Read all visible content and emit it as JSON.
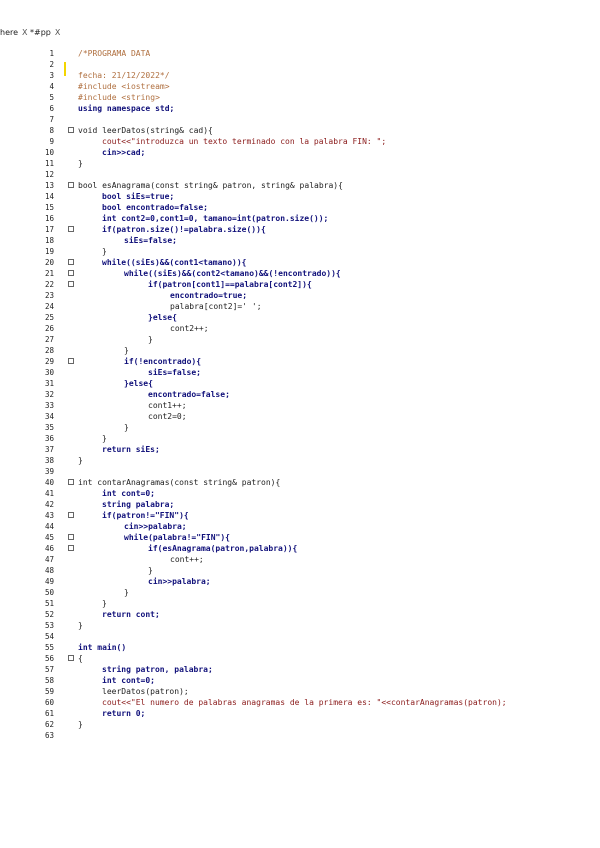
{
  "tabs": [
    {
      "label": "here",
      "close": "X"
    },
    {
      "label": "*#pp",
      "close": "X"
    }
  ],
  "lines": [
    {
      "n": "1",
      "indent": 0,
      "text": "/*PROGRAMA DATA",
      "cls": "com"
    },
    {
      "n": "2",
      "indent": 0,
      "text": "",
      "cls": ""
    },
    {
      "n": "3",
      "indent": 0,
      "text": "fecha: 21/12/2022*/",
      "cls": "com"
    },
    {
      "n": "4",
      "indent": 0,
      "text": "#include <iostream>",
      "cls": "com"
    },
    {
      "n": "5",
      "indent": 0,
      "text": "#include <string>",
      "cls": "com"
    },
    {
      "n": "6",
      "indent": 0,
      "text": "using namespace std;",
      "cls": "kw"
    },
    {
      "n": "7",
      "indent": 0,
      "text": "",
      "cls": ""
    },
    {
      "n": "8",
      "indent": 0,
      "text": "void leerDatos(string& cad){",
      "cls": "",
      "fold": true
    },
    {
      "n": "9",
      "indent": 1,
      "text": "cout<<\"introduzca un texto terminado con la palabra FIN: \";",
      "cls": "str"
    },
    {
      "n": "10",
      "indent": 1,
      "text": "cin>>cad;",
      "cls": "kw"
    },
    {
      "n": "11",
      "indent": 0,
      "text": "}",
      "cls": ""
    },
    {
      "n": "12",
      "indent": 0,
      "text": "",
      "cls": ""
    },
    {
      "n": "13",
      "indent": 0,
      "text": "bool esAnagrama(const string& patron, string& palabra){",
      "cls": "",
      "fold": true
    },
    {
      "n": "14",
      "indent": 1,
      "text": "bool siEs=true;",
      "cls": "kw"
    },
    {
      "n": "15",
      "indent": 1,
      "text": "bool encontrado=false;",
      "cls": "kw"
    },
    {
      "n": "16",
      "indent": 1,
      "text": "int cont2=0,cont1=0, tamano=int(patron.size());",
      "cls": "kw"
    },
    {
      "n": "17",
      "indent": 1,
      "text": "if(patron.size()!=palabra.size()){",
      "cls": "kw",
      "fold": true
    },
    {
      "n": "18",
      "indent": 2,
      "text": "siEs=false;",
      "cls": "kw"
    },
    {
      "n": "19",
      "indent": 1,
      "text": "}",
      "cls": ""
    },
    {
      "n": "20",
      "indent": 1,
      "text": "while((siEs)&&(cont1<tamano)){",
      "cls": "kw",
      "fold": true
    },
    {
      "n": "21",
      "indent": 2,
      "text": "while((siEs)&&(cont2<tamano)&&(!encontrado)){",
      "cls": "kw",
      "fold": true
    },
    {
      "n": "22",
      "indent": 3,
      "text": "if(patron[cont1]==palabra[cont2]){",
      "cls": "kw",
      "fold": true
    },
    {
      "n": "23",
      "indent": 4,
      "text": "encontrado=true;",
      "cls": "kw"
    },
    {
      "n": "24",
      "indent": 4,
      "text": "palabra[cont2]=' ';",
      "cls": ""
    },
    {
      "n": "25",
      "indent": 3,
      "text": "}else{",
      "cls": "kw"
    },
    {
      "n": "26",
      "indent": 4,
      "text": "cont2++;",
      "cls": ""
    },
    {
      "n": "27",
      "indent": 3,
      "text": "}",
      "cls": ""
    },
    {
      "n": "28",
      "indent": 2,
      "text": "}",
      "cls": ""
    },
    {
      "n": "29",
      "indent": 2,
      "text": "if(!encontrado){",
      "cls": "kw",
      "fold": true
    },
    {
      "n": "30",
      "indent": 3,
      "text": "siEs=false;",
      "cls": "kw"
    },
    {
      "n": "31",
      "indent": 2,
      "text": "}else{",
      "cls": "kw"
    },
    {
      "n": "32",
      "indent": 3,
      "text": "encontrado=false;",
      "cls": "kw"
    },
    {
      "n": "33",
      "indent": 3,
      "text": "cont1++;",
      "cls": ""
    },
    {
      "n": "34",
      "indent": 3,
      "text": "cont2=0;",
      "cls": ""
    },
    {
      "n": "35",
      "indent": 2,
      "text": "}",
      "cls": ""
    },
    {
      "n": "36",
      "indent": 1,
      "text": "}",
      "cls": ""
    },
    {
      "n": "37",
      "indent": 1,
      "text": "return siEs;",
      "cls": "kw"
    },
    {
      "n": "38",
      "indent": 0,
      "text": "}",
      "cls": ""
    },
    {
      "n": "39",
      "indent": 0,
      "text": "",
      "cls": ""
    },
    {
      "n": "40",
      "indent": 0,
      "text": "int contarAnagramas(const string& patron){",
      "cls": "",
      "fold": true
    },
    {
      "n": "41",
      "indent": 1,
      "text": "int cont=0;",
      "cls": "kw"
    },
    {
      "n": "42",
      "indent": 1,
      "text": "string palabra;",
      "cls": "kw"
    },
    {
      "n": "43",
      "indent": 1,
      "text": "if(patron!=\"FIN\"){",
      "cls": "kw",
      "fold": true
    },
    {
      "n": "44",
      "indent": 2,
      "text": "cin>>palabra;",
      "cls": "kw"
    },
    {
      "n": "45",
      "indent": 2,
      "text": "while(palabra!=\"FIN\"){",
      "cls": "kw",
      "fold": true
    },
    {
      "n": "46",
      "indent": 3,
      "text": "if(esAnagrama(patron,palabra)){",
      "cls": "kw",
      "fold": true
    },
    {
      "n": "47",
      "indent": 4,
      "text": "cont++;",
      "cls": ""
    },
    {
      "n": "48",
      "indent": 3,
      "text": "}",
      "cls": ""
    },
    {
      "n": "49",
      "indent": 3,
      "text": "cin>>palabra;",
      "cls": "kw"
    },
    {
      "n": "50",
      "indent": 2,
      "text": "}",
      "cls": ""
    },
    {
      "n": "51",
      "indent": 1,
      "text": "}",
      "cls": ""
    },
    {
      "n": "52",
      "indent": 1,
      "text": "return cont;",
      "cls": "kw"
    },
    {
      "n": "53",
      "indent": 0,
      "text": "}",
      "cls": ""
    },
    {
      "n": "54",
      "indent": 0,
      "text": "",
      "cls": ""
    },
    {
      "n": "55",
      "indent": 0,
      "text": "int main()",
      "cls": "kw"
    },
    {
      "n": "56",
      "indent": 0,
      "text": "{",
      "cls": "",
      "fold": true
    },
    {
      "n": "57",
      "indent": 1,
      "text": "string patron, palabra;",
      "cls": "kw"
    },
    {
      "n": "58",
      "indent": 1,
      "text": "int cont=0;",
      "cls": "kw"
    },
    {
      "n": "59",
      "indent": 1,
      "text": "leerDatos(patron);",
      "cls": ""
    },
    {
      "n": "60",
      "indent": 1,
      "text": "cout<<\"El numero de palabras anagramas de la primera es: \"<<contarAnagramas(patron);",
      "cls": "str"
    },
    {
      "n": "61",
      "indent": 1,
      "text": "return 0;",
      "cls": "kw"
    },
    {
      "n": "62",
      "indent": 0,
      "text": "}",
      "cls": ""
    },
    {
      "n": "63",
      "indent": 0,
      "text": "",
      "cls": ""
    }
  ]
}
